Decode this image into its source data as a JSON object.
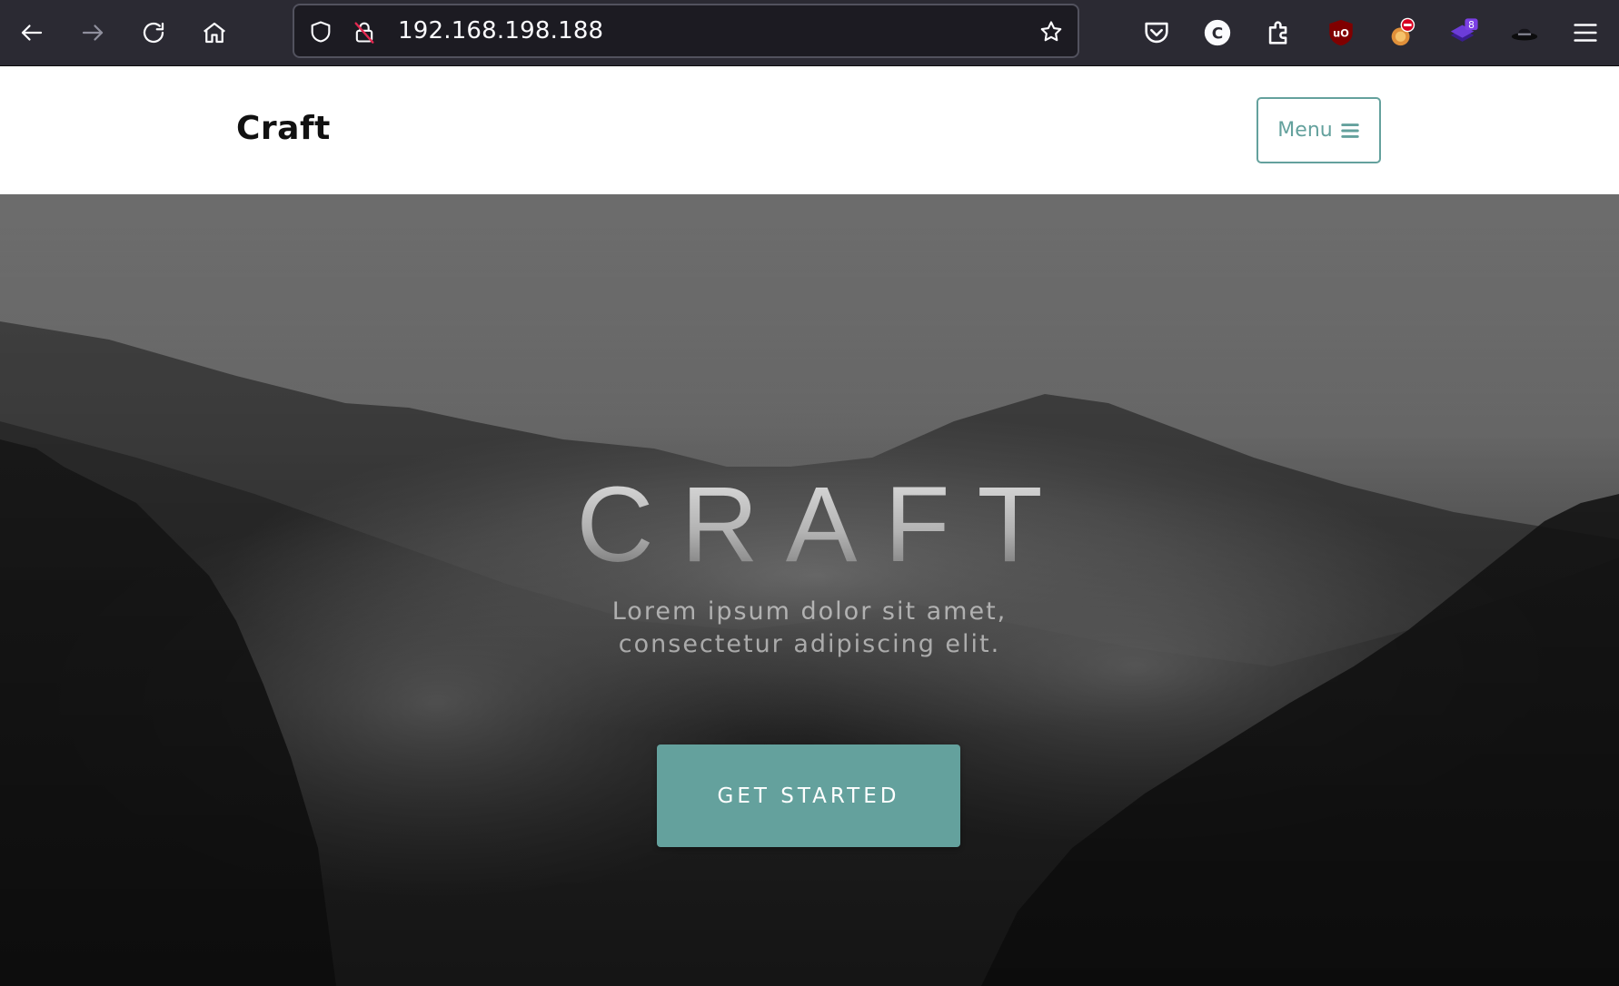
{
  "browser": {
    "url": "192.168.198.188",
    "extension_badge_count": "8",
    "colors": {
      "toolbar_bg": "#2b2a33",
      "urlbar_bg": "#1c1b22",
      "icon": "#fbfbfe"
    },
    "icons": [
      "back-icon",
      "forward-icon",
      "reload-icon",
      "home-icon",
      "shield-icon",
      "insecure-lock-icon",
      "bookmark-star-icon",
      "pocket-icon",
      "c-extension-icon",
      "extensions-puzzle-icon",
      "ublock-icon",
      "blocker-extension-icon",
      "stack-extension-icon",
      "hat-extension-icon",
      "hamburger-menu-icon"
    ]
  },
  "site": {
    "brand": "Craft",
    "menu_label": "Menu",
    "accent_color": "#64a19d"
  },
  "hero": {
    "title": "CRAFT",
    "subtitle": "Lorem ipsum dolor sit amet, consectetur adipiscing elit.",
    "cta_label": "GET STARTED"
  }
}
